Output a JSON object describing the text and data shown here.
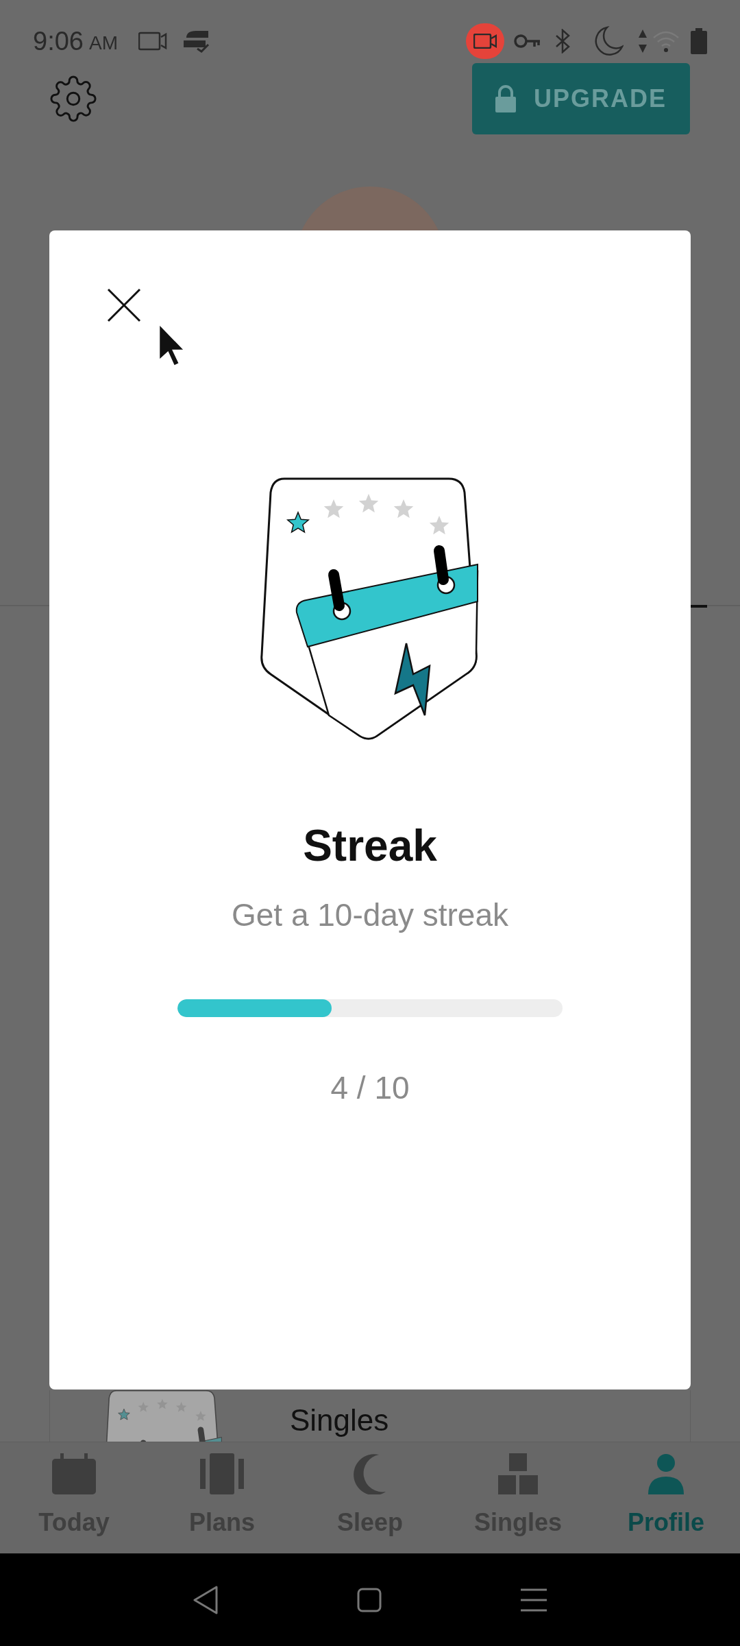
{
  "status_bar": {
    "time": "9:06",
    "meridiem": "AM"
  },
  "header": {
    "upgrade_button": "UPGRADE"
  },
  "modal": {
    "title": "Streak",
    "subtitle": "Get a 10-day streak",
    "progress": {
      "level": 0.4,
      "reading": "4 / 10"
    }
  },
  "background_card": {
    "title": "Singles"
  },
  "tabs": [
    {
      "label": "Today",
      "selected": false
    },
    {
      "label": "Plans",
      "selected": false
    },
    {
      "label": "Sleep",
      "selected": false
    },
    {
      "label": "Singles",
      "selected": false
    },
    {
      "label": "Profile",
      "selected": true
    }
  ]
}
